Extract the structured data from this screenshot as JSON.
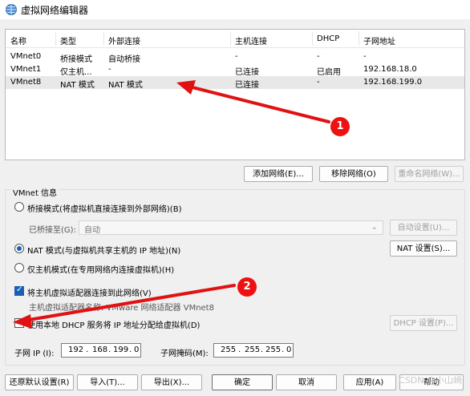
{
  "window": {
    "title": "虚拟网络编辑器"
  },
  "list": {
    "columns": [
      "名称",
      "类型",
      "外部连接",
      "主机连接",
      "DHCP",
      "子网地址"
    ],
    "rows": [
      [
        "VMnet0",
        "桥接模式",
        "自动桥接",
        "-",
        "-",
        "-"
      ],
      [
        "VMnet1",
        "仅主机...",
        "-",
        "已连接",
        "已启用",
        "192.168.18.0"
      ],
      [
        "VMnet8",
        "NAT 模式",
        "NAT 模式",
        "已连接",
        "-",
        "192.168.199.0"
      ]
    ],
    "selected_row": "VMnet8"
  },
  "list_buttons": {
    "add": "添加网络(E)...",
    "remove": "移除网络(O)",
    "rename": "重命名网络(W)..."
  },
  "info": {
    "group_title": "VMnet 信息",
    "bridged_label": "桥接模式(将虚拟机直接连接到外部网络)(B)",
    "bridged_to_label": "已桥接至(G):",
    "bridged_to_value": "自动",
    "auto_settings": "自动设置(U)...",
    "nat_label": "NAT 模式(与虚拟机共享主机的 IP 地址)(N)",
    "nat_settings": "NAT 设置(S)...",
    "host_only_label": "仅主机模式(在专用网络内连接虚拟机)(H)",
    "connect_adapter_label": "将主机虚拟适配器连接到此网络(V)",
    "adapter_name": "主机虚拟适配器名称: VMware 网络适配器 VMnet8",
    "dhcp_label": "使用本地 DHCP 服务将 IP 地址分配给虚拟机(D)",
    "dhcp_settings": "DHCP 设置(P)...",
    "subnet_ip_label": "子网 IP (I):",
    "subnet_ip": [
      "192",
      "168",
      "199",
      "0"
    ],
    "subnet_mask_label": "子网掩码(M):",
    "subnet_mask": [
      "255",
      "255",
      "255",
      "0"
    ]
  },
  "footer": {
    "restore": "还原默认设置(R)",
    "import": "导入(T)...",
    "export": "导出(X)...",
    "ok": "确定",
    "cancel": "取消",
    "apply": "应用(A)",
    "help": "帮助"
  },
  "annotations": {
    "badge1": "1",
    "badge2": "2"
  },
  "watermark": "CSDN @小山崎",
  "colors": {
    "accent": "#1a5fb4",
    "arrow": "#e11111"
  }
}
